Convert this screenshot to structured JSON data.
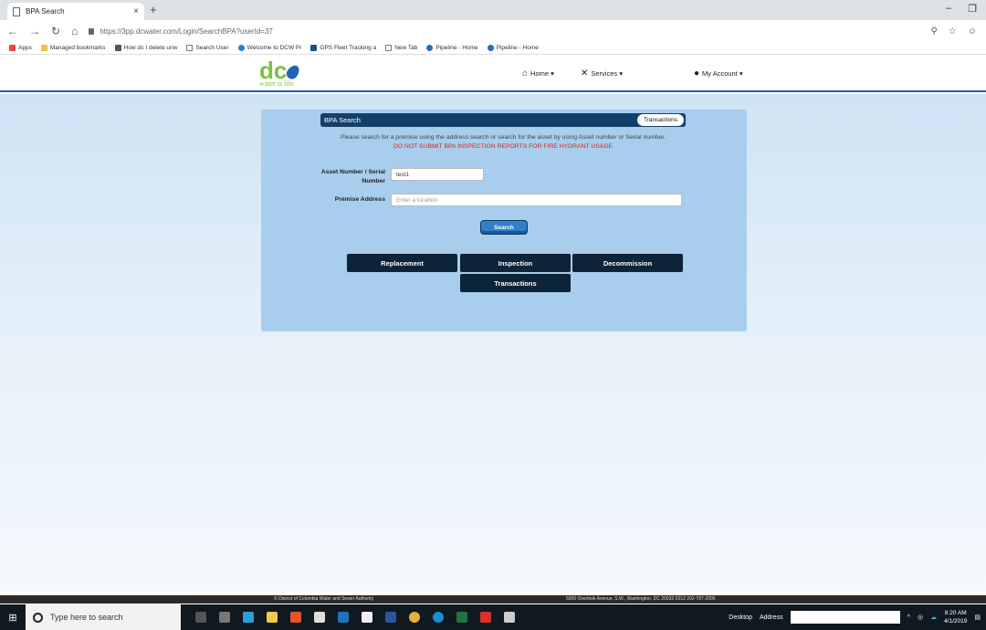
{
  "browser": {
    "tab_title": "BPA Search",
    "tab_close": "×",
    "new_tab": "+",
    "url": "https://3pp.dcwater.com/Login/SearchBPA?userId=37",
    "bookmarks": [
      "Apps",
      "Managed bookmarks",
      "How do I delete unw",
      "Search User",
      "Welcome to DCW Pr",
      "GPS Fleet Tracking a",
      "New Tab",
      "Pipeline - Home",
      "Pipeline - Home"
    ]
  },
  "site": {
    "logo_text": "dc",
    "logo_tagline": "water is life",
    "nav": {
      "home": "Home ▾",
      "services": "Services ▾",
      "account": "My Account ▾"
    }
  },
  "panel": {
    "title": "BPA Search",
    "transactions_pill": "Transactions",
    "info": "Please search for a premise using the address search or search for the asset by using Asset number or Serial number.",
    "warning": "DO NOT SUBMIT BPA INSPECTION REPORTS FOR FIRE HYDRANT USAGE",
    "asset_label": "Asset Number / Serial Number",
    "asset_value": "test1",
    "premise_label": "Premise Address",
    "premise_placeholder": "Enter a location",
    "search_button": "Search",
    "actions": [
      "Replacement",
      "Inspection",
      "Decommission",
      "Transactions"
    ]
  },
  "footer": {
    "left": "© District of Columbia Water and Sewer Authority",
    "right": "5000 Overlook Avenue, S.W., Washington, DC 20032-5212 202-787-2000"
  },
  "taskbar": {
    "search_placeholder": "Type here to search",
    "desktop": "Desktop",
    "address": "Address",
    "time": "8:20 AM",
    "date": "4/1/2019"
  }
}
